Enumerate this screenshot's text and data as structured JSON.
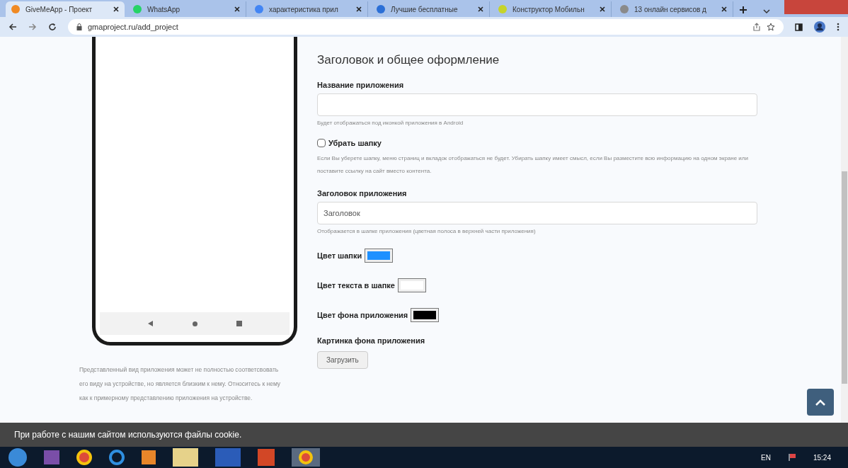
{
  "browser": {
    "tabs": [
      {
        "title": "GiveMeApp - Проект",
        "selected": true
      },
      {
        "title": "WhatsApp",
        "selected": false
      },
      {
        "title": "характеристика прил",
        "selected": false
      },
      {
        "title": "Лучшие бесплатные",
        "selected": false
      },
      {
        "title": "Конструктор Мобильн",
        "selected": false
      },
      {
        "title": "13 онлайн сервисов д",
        "selected": false
      }
    ],
    "url": "gmaproject.ru/add_project"
  },
  "preview": {
    "note": "Представленный вид приложения может не полностью соответсвовать его виду на устройстве, но является близким к нему. Относитесь к нему как к примерному представлению приложения на устройстве."
  },
  "form": {
    "section_title": "Заголовок и общее оформление",
    "app_name": {
      "label": "Название приложения",
      "hint": "Будет отображаться под иконкой приложения в Android"
    },
    "hide_header": {
      "label": "Убрать шапку",
      "checked": false,
      "hint": "Если Вы уберете шапку, меню страниц и вкладок отображаться не будет. Убирать шапку имеет смысл, если Вы разместите всю информацию на одном экране или поставите ссылку на сайт вместо контента."
    },
    "app_title": {
      "label": "Заголовок приложения",
      "value": "Заголовок",
      "hint": "Отображается в шапке приложения (цветная полоса в верхней части приложения)"
    },
    "colors": [
      {
        "label": "Цвет шапки",
        "color": "#1e90ff"
      },
      {
        "label": "Цвет текста в шапке",
        "color": "#ffffff"
      },
      {
        "label": "Цвет фона приложения",
        "color": "#000000"
      }
    ],
    "background_image": {
      "label": "Картинка фона приложения",
      "button": "Загрузить"
    }
  },
  "cookie_notice": "При работе с нашим сайтом используются файлы cookie.",
  "taskbar": {
    "language": "EN",
    "time": "15:24"
  }
}
